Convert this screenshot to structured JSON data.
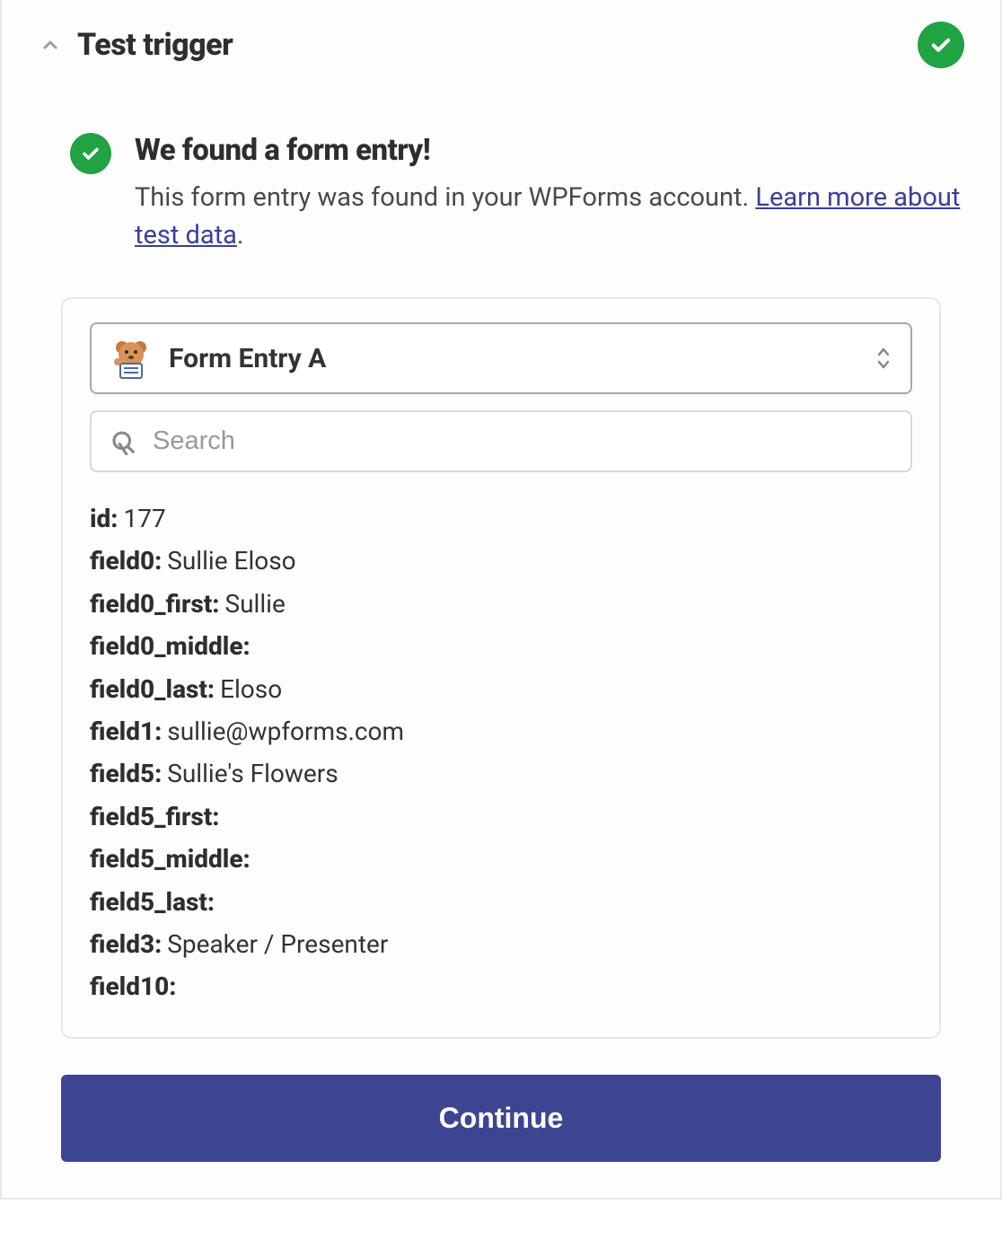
{
  "header": {
    "title": "Test trigger"
  },
  "message": {
    "heading": "We found a form entry!",
    "body_prefix": "This form entry was found in your WPForms account. ",
    "link_text": "Learn more about test data",
    "body_suffix": "."
  },
  "dropdown": {
    "selected": "Form Entry A"
  },
  "search": {
    "placeholder": "Search"
  },
  "fields": [
    {
      "key": "id:",
      "value": "177"
    },
    {
      "key": "field0:",
      "value": "Sullie Eloso"
    },
    {
      "key": "field0_first:",
      "value": "Sullie"
    },
    {
      "key": "field0_middle:",
      "value": ""
    },
    {
      "key": "field0_last:",
      "value": "Eloso"
    },
    {
      "key": "field1:",
      "value": "sullie@wpforms.com"
    },
    {
      "key": "field5:",
      "value": "Sullie's Flowers"
    },
    {
      "key": "field5_first:",
      "value": ""
    },
    {
      "key": "field5_middle:",
      "value": ""
    },
    {
      "key": "field5_last:",
      "value": ""
    },
    {
      "key": "field3:",
      "value": "Speaker / Presenter"
    },
    {
      "key": "field10:",
      "value": ""
    }
  ],
  "continue_label": "Continue"
}
